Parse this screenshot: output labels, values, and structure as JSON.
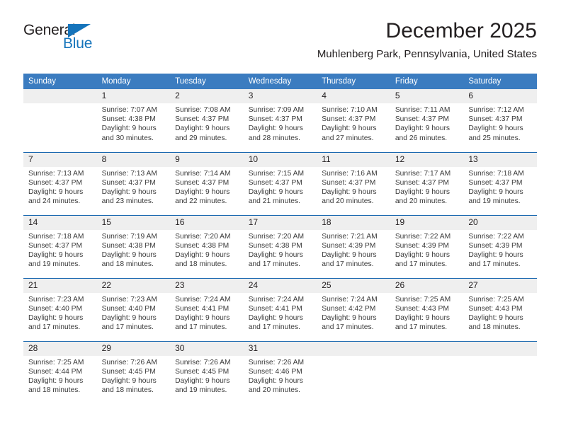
{
  "logo": {
    "word_top": "General",
    "word_bottom": "Blue",
    "accent_color": "#1574bb",
    "triangle_icon": "triangle-icon"
  },
  "header": {
    "title": "December 2025",
    "subtitle": "Muhlenberg Park, Pennsylvania, United States"
  },
  "colors": {
    "header_blue": "#3b7cc0",
    "row_divider_blue": "#1b69b0",
    "daynum_band": "#efefef",
    "text": "#231f20"
  },
  "weekdays": [
    "Sunday",
    "Monday",
    "Tuesday",
    "Wednesday",
    "Thursday",
    "Friday",
    "Saturday"
  ],
  "labels": {
    "sunrise_prefix": "Sunrise:",
    "sunset_prefix": "Sunset:",
    "daylight_prefix": "Daylight:"
  },
  "weeks": [
    {
      "days": [
        {
          "num": "",
          "sunrise": "",
          "sunset": "",
          "daylight_line1": "",
          "daylight_line2": ""
        },
        {
          "num": "1",
          "sunrise": "Sunrise: 7:07 AM",
          "sunset": "Sunset: 4:38 PM",
          "daylight_line1": "Daylight: 9 hours",
          "daylight_line2": "and 30 minutes."
        },
        {
          "num": "2",
          "sunrise": "Sunrise: 7:08 AM",
          "sunset": "Sunset: 4:37 PM",
          "daylight_line1": "Daylight: 9 hours",
          "daylight_line2": "and 29 minutes."
        },
        {
          "num": "3",
          "sunrise": "Sunrise: 7:09 AM",
          "sunset": "Sunset: 4:37 PM",
          "daylight_line1": "Daylight: 9 hours",
          "daylight_line2": "and 28 minutes."
        },
        {
          "num": "4",
          "sunrise": "Sunrise: 7:10 AM",
          "sunset": "Sunset: 4:37 PM",
          "daylight_line1": "Daylight: 9 hours",
          "daylight_line2": "and 27 minutes."
        },
        {
          "num": "5",
          "sunrise": "Sunrise: 7:11 AM",
          "sunset": "Sunset: 4:37 PM",
          "daylight_line1": "Daylight: 9 hours",
          "daylight_line2": "and 26 minutes."
        },
        {
          "num": "6",
          "sunrise": "Sunrise: 7:12 AM",
          "sunset": "Sunset: 4:37 PM",
          "daylight_line1": "Daylight: 9 hours",
          "daylight_line2": "and 25 minutes."
        }
      ]
    },
    {
      "days": [
        {
          "num": "7",
          "sunrise": "Sunrise: 7:13 AM",
          "sunset": "Sunset: 4:37 PM",
          "daylight_line1": "Daylight: 9 hours",
          "daylight_line2": "and 24 minutes."
        },
        {
          "num": "8",
          "sunrise": "Sunrise: 7:13 AM",
          "sunset": "Sunset: 4:37 PM",
          "daylight_line1": "Daylight: 9 hours",
          "daylight_line2": "and 23 minutes."
        },
        {
          "num": "9",
          "sunrise": "Sunrise: 7:14 AM",
          "sunset": "Sunset: 4:37 PM",
          "daylight_line1": "Daylight: 9 hours",
          "daylight_line2": "and 22 minutes."
        },
        {
          "num": "10",
          "sunrise": "Sunrise: 7:15 AM",
          "sunset": "Sunset: 4:37 PM",
          "daylight_line1": "Daylight: 9 hours",
          "daylight_line2": "and 21 minutes."
        },
        {
          "num": "11",
          "sunrise": "Sunrise: 7:16 AM",
          "sunset": "Sunset: 4:37 PM",
          "daylight_line1": "Daylight: 9 hours",
          "daylight_line2": "and 20 minutes."
        },
        {
          "num": "12",
          "sunrise": "Sunrise: 7:17 AM",
          "sunset": "Sunset: 4:37 PM",
          "daylight_line1": "Daylight: 9 hours",
          "daylight_line2": "and 20 minutes."
        },
        {
          "num": "13",
          "sunrise": "Sunrise: 7:18 AM",
          "sunset": "Sunset: 4:37 PM",
          "daylight_line1": "Daylight: 9 hours",
          "daylight_line2": "and 19 minutes."
        }
      ]
    },
    {
      "days": [
        {
          "num": "14",
          "sunrise": "Sunrise: 7:18 AM",
          "sunset": "Sunset: 4:37 PM",
          "daylight_line1": "Daylight: 9 hours",
          "daylight_line2": "and 19 minutes."
        },
        {
          "num": "15",
          "sunrise": "Sunrise: 7:19 AM",
          "sunset": "Sunset: 4:38 PM",
          "daylight_line1": "Daylight: 9 hours",
          "daylight_line2": "and 18 minutes."
        },
        {
          "num": "16",
          "sunrise": "Sunrise: 7:20 AM",
          "sunset": "Sunset: 4:38 PM",
          "daylight_line1": "Daylight: 9 hours",
          "daylight_line2": "and 18 minutes."
        },
        {
          "num": "17",
          "sunrise": "Sunrise: 7:20 AM",
          "sunset": "Sunset: 4:38 PM",
          "daylight_line1": "Daylight: 9 hours",
          "daylight_line2": "and 17 minutes."
        },
        {
          "num": "18",
          "sunrise": "Sunrise: 7:21 AM",
          "sunset": "Sunset: 4:39 PM",
          "daylight_line1": "Daylight: 9 hours",
          "daylight_line2": "and 17 minutes."
        },
        {
          "num": "19",
          "sunrise": "Sunrise: 7:22 AM",
          "sunset": "Sunset: 4:39 PM",
          "daylight_line1": "Daylight: 9 hours",
          "daylight_line2": "and 17 minutes."
        },
        {
          "num": "20",
          "sunrise": "Sunrise: 7:22 AM",
          "sunset": "Sunset: 4:39 PM",
          "daylight_line1": "Daylight: 9 hours",
          "daylight_line2": "and 17 minutes."
        }
      ]
    },
    {
      "days": [
        {
          "num": "21",
          "sunrise": "Sunrise: 7:23 AM",
          "sunset": "Sunset: 4:40 PM",
          "daylight_line1": "Daylight: 9 hours",
          "daylight_line2": "and 17 minutes."
        },
        {
          "num": "22",
          "sunrise": "Sunrise: 7:23 AM",
          "sunset": "Sunset: 4:40 PM",
          "daylight_line1": "Daylight: 9 hours",
          "daylight_line2": "and 17 minutes."
        },
        {
          "num": "23",
          "sunrise": "Sunrise: 7:24 AM",
          "sunset": "Sunset: 4:41 PM",
          "daylight_line1": "Daylight: 9 hours",
          "daylight_line2": "and 17 minutes."
        },
        {
          "num": "24",
          "sunrise": "Sunrise: 7:24 AM",
          "sunset": "Sunset: 4:41 PM",
          "daylight_line1": "Daylight: 9 hours",
          "daylight_line2": "and 17 minutes."
        },
        {
          "num": "25",
          "sunrise": "Sunrise: 7:24 AM",
          "sunset": "Sunset: 4:42 PM",
          "daylight_line1": "Daylight: 9 hours",
          "daylight_line2": "and 17 minutes."
        },
        {
          "num": "26",
          "sunrise": "Sunrise: 7:25 AM",
          "sunset": "Sunset: 4:43 PM",
          "daylight_line1": "Daylight: 9 hours",
          "daylight_line2": "and 17 minutes."
        },
        {
          "num": "27",
          "sunrise": "Sunrise: 7:25 AM",
          "sunset": "Sunset: 4:43 PM",
          "daylight_line1": "Daylight: 9 hours",
          "daylight_line2": "and 18 minutes."
        }
      ]
    },
    {
      "days": [
        {
          "num": "28",
          "sunrise": "Sunrise: 7:25 AM",
          "sunset": "Sunset: 4:44 PM",
          "daylight_line1": "Daylight: 9 hours",
          "daylight_line2": "and 18 minutes."
        },
        {
          "num": "29",
          "sunrise": "Sunrise: 7:26 AM",
          "sunset": "Sunset: 4:45 PM",
          "daylight_line1": "Daylight: 9 hours",
          "daylight_line2": "and 18 minutes."
        },
        {
          "num": "30",
          "sunrise": "Sunrise: 7:26 AM",
          "sunset": "Sunset: 4:45 PM",
          "daylight_line1": "Daylight: 9 hours",
          "daylight_line2": "and 19 minutes."
        },
        {
          "num": "31",
          "sunrise": "Sunrise: 7:26 AM",
          "sunset": "Sunset: 4:46 PM",
          "daylight_line1": "Daylight: 9 hours",
          "daylight_line2": "and 20 minutes."
        },
        {
          "num": "",
          "sunrise": "",
          "sunset": "",
          "daylight_line1": "",
          "daylight_line2": ""
        },
        {
          "num": "",
          "sunrise": "",
          "sunset": "",
          "daylight_line1": "",
          "daylight_line2": ""
        },
        {
          "num": "",
          "sunrise": "",
          "sunset": "",
          "daylight_line1": "",
          "daylight_line2": ""
        }
      ]
    }
  ]
}
